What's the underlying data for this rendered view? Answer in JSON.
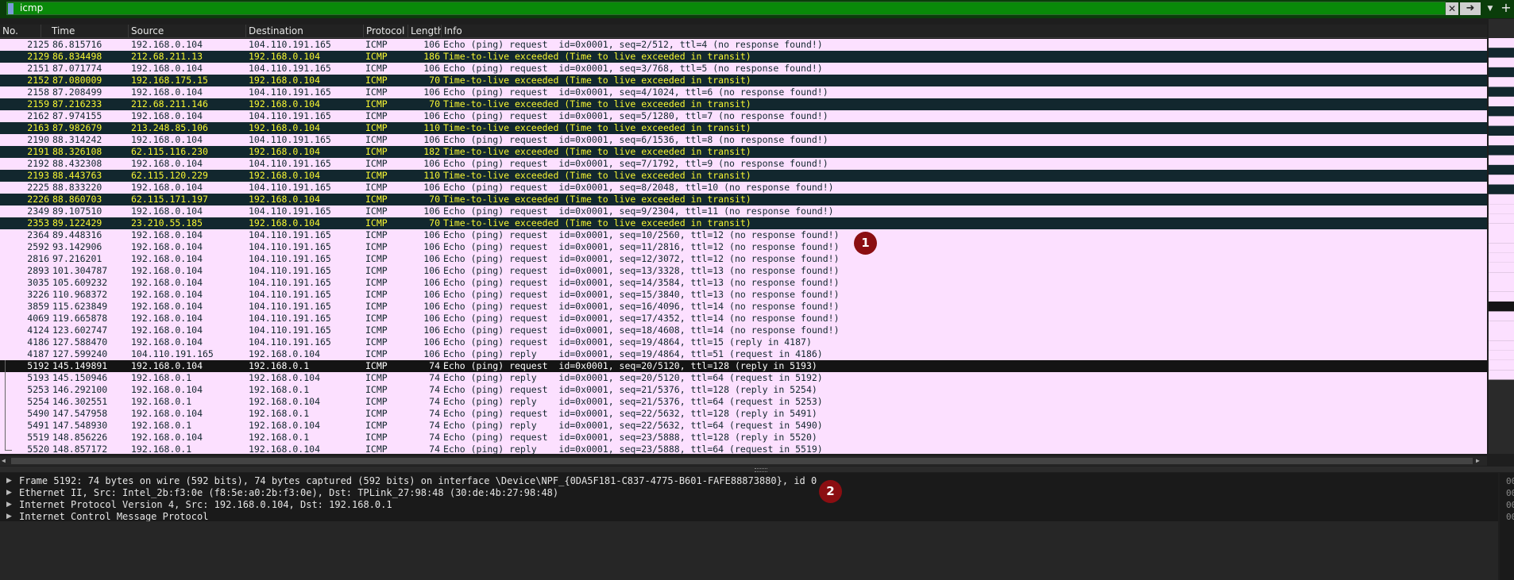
{
  "filter": {
    "value": "icmp",
    "clear_glyph": "✕",
    "apply_glyph": "➜",
    "dropdown_glyph": "▼",
    "add_glyph": "+"
  },
  "columns": [
    "No.",
    "Time",
    "Source",
    "Destination",
    "Protocol",
    "Length",
    "Info"
  ],
  "packets": [
    {
      "no": "2125",
      "time": "86.815716",
      "src": "192.168.0.104",
      "dst": "104.110.191.165",
      "proto": "ICMP",
      "len": "106",
      "info": "Echo (ping) request  id=0x0001, seq=2/512, ttl=4 (no response found!)",
      "kind": "echo"
    },
    {
      "no": "2129",
      "time": "86.834498",
      "src": "212.68.211.13",
      "dst": "192.168.0.104",
      "proto": "ICMP",
      "len": "186",
      "info": "Time-to-live exceeded (Time to live exceeded in transit)",
      "kind": "ttl"
    },
    {
      "no": "2151",
      "time": "87.071774",
      "src": "192.168.0.104",
      "dst": "104.110.191.165",
      "proto": "ICMP",
      "len": "106",
      "info": "Echo (ping) request  id=0x0001, seq=3/768, ttl=5 (no response found!)",
      "kind": "echo"
    },
    {
      "no": "2152",
      "time": "87.080009",
      "src": "192.168.175.15",
      "dst": "192.168.0.104",
      "proto": "ICMP",
      "len": "70",
      "info": "Time-to-live exceeded (Time to live exceeded in transit)",
      "kind": "ttl"
    },
    {
      "no": "2158",
      "time": "87.208499",
      "src": "192.168.0.104",
      "dst": "104.110.191.165",
      "proto": "ICMP",
      "len": "106",
      "info": "Echo (ping) request  id=0x0001, seq=4/1024, ttl=6 (no response found!)",
      "kind": "echo"
    },
    {
      "no": "2159",
      "time": "87.216233",
      "src": "212.68.211.146",
      "dst": "192.168.0.104",
      "proto": "ICMP",
      "len": "70",
      "info": "Time-to-live exceeded (Time to live exceeded in transit)",
      "kind": "ttl"
    },
    {
      "no": "2162",
      "time": "87.974155",
      "src": "192.168.0.104",
      "dst": "104.110.191.165",
      "proto": "ICMP",
      "len": "106",
      "info": "Echo (ping) request  id=0x0001, seq=5/1280, ttl=7 (no response found!)",
      "kind": "echo"
    },
    {
      "no": "2163",
      "time": "87.982679",
      "src": "213.248.85.106",
      "dst": "192.168.0.104",
      "proto": "ICMP",
      "len": "110",
      "info": "Time-to-live exceeded (Time to live exceeded in transit)",
      "kind": "ttl"
    },
    {
      "no": "2190",
      "time": "88.314242",
      "src": "192.168.0.104",
      "dst": "104.110.191.165",
      "proto": "ICMP",
      "len": "106",
      "info": "Echo (ping) request  id=0x0001, seq=6/1536, ttl=8 (no response found!)",
      "kind": "echo"
    },
    {
      "no": "2191",
      "time": "88.326108",
      "src": "62.115.116.230",
      "dst": "192.168.0.104",
      "proto": "ICMP",
      "len": "182",
      "info": "Time-to-live exceeded (Time to live exceeded in transit)",
      "kind": "ttl"
    },
    {
      "no": "2192",
      "time": "88.432308",
      "src": "192.168.0.104",
      "dst": "104.110.191.165",
      "proto": "ICMP",
      "len": "106",
      "info": "Echo (ping) request  id=0x0001, seq=7/1792, ttl=9 (no response found!)",
      "kind": "echo"
    },
    {
      "no": "2193",
      "time": "88.443763",
      "src": "62.115.120.229",
      "dst": "192.168.0.104",
      "proto": "ICMP",
      "len": "110",
      "info": "Time-to-live exceeded (Time to live exceeded in transit)",
      "kind": "ttl"
    },
    {
      "no": "2225",
      "time": "88.833220",
      "src": "192.168.0.104",
      "dst": "104.110.191.165",
      "proto": "ICMP",
      "len": "106",
      "info": "Echo (ping) request  id=0x0001, seq=8/2048, ttl=10 (no response found!)",
      "kind": "echo"
    },
    {
      "no": "2226",
      "time": "88.860703",
      "src": "62.115.171.197",
      "dst": "192.168.0.104",
      "proto": "ICMP",
      "len": "70",
      "info": "Time-to-live exceeded (Time to live exceeded in transit)",
      "kind": "ttl"
    },
    {
      "no": "2349",
      "time": "89.107510",
      "src": "192.168.0.104",
      "dst": "104.110.191.165",
      "proto": "ICMP",
      "len": "106",
      "info": "Echo (ping) request  id=0x0001, seq=9/2304, ttl=11 (no response found!)",
      "kind": "echo"
    },
    {
      "no": "2353",
      "time": "89.122429",
      "src": "23.210.55.185",
      "dst": "192.168.0.104",
      "proto": "ICMP",
      "len": "70",
      "info": "Time-to-live exceeded (Time to live exceeded in transit)",
      "kind": "ttl"
    },
    {
      "no": "2364",
      "time": "89.448316",
      "src": "192.168.0.104",
      "dst": "104.110.191.165",
      "proto": "ICMP",
      "len": "106",
      "info": "Echo (ping) request  id=0x0001, seq=10/2560, ttl=12 (no response found!)",
      "kind": "echo"
    },
    {
      "no": "2592",
      "time": "93.142906",
      "src": "192.168.0.104",
      "dst": "104.110.191.165",
      "proto": "ICMP",
      "len": "106",
      "info": "Echo (ping) request  id=0x0001, seq=11/2816, ttl=12 (no response found!)",
      "kind": "echo"
    },
    {
      "no": "2816",
      "time": "97.216201",
      "src": "192.168.0.104",
      "dst": "104.110.191.165",
      "proto": "ICMP",
      "len": "106",
      "info": "Echo (ping) request  id=0x0001, seq=12/3072, ttl=12 (no response found!)",
      "kind": "echo"
    },
    {
      "no": "2893",
      "time": "101.304787",
      "src": "192.168.0.104",
      "dst": "104.110.191.165",
      "proto": "ICMP",
      "len": "106",
      "info": "Echo (ping) request  id=0x0001, seq=13/3328, ttl=13 (no response found!)",
      "kind": "echo"
    },
    {
      "no": "3035",
      "time": "105.609232",
      "src": "192.168.0.104",
      "dst": "104.110.191.165",
      "proto": "ICMP",
      "len": "106",
      "info": "Echo (ping) request  id=0x0001, seq=14/3584, ttl=13 (no response found!)",
      "kind": "echo"
    },
    {
      "no": "3226",
      "time": "110.968372",
      "src": "192.168.0.104",
      "dst": "104.110.191.165",
      "proto": "ICMP",
      "len": "106",
      "info": "Echo (ping) request  id=0x0001, seq=15/3840, ttl=13 (no response found!)",
      "kind": "echo"
    },
    {
      "no": "3859",
      "time": "115.623849",
      "src": "192.168.0.104",
      "dst": "104.110.191.165",
      "proto": "ICMP",
      "len": "106",
      "info": "Echo (ping) request  id=0x0001, seq=16/4096, ttl=14 (no response found!)",
      "kind": "echo"
    },
    {
      "no": "4069",
      "time": "119.665878",
      "src": "192.168.0.104",
      "dst": "104.110.191.165",
      "proto": "ICMP",
      "len": "106",
      "info": "Echo (ping) request  id=0x0001, seq=17/4352, ttl=14 (no response found!)",
      "kind": "echo"
    },
    {
      "no": "4124",
      "time": "123.602747",
      "src": "192.168.0.104",
      "dst": "104.110.191.165",
      "proto": "ICMP",
      "len": "106",
      "info": "Echo (ping) request  id=0x0001, seq=18/4608, ttl=14 (no response found!)",
      "kind": "echo"
    },
    {
      "no": "4186",
      "time": "127.588470",
      "src": "192.168.0.104",
      "dst": "104.110.191.165",
      "proto": "ICMP",
      "len": "106",
      "info": "Echo (ping) request  id=0x0001, seq=19/4864, ttl=15 (reply in 4187)",
      "kind": "echo"
    },
    {
      "no": "4187",
      "time": "127.599240",
      "src": "104.110.191.165",
      "dst": "192.168.0.104",
      "proto": "ICMP",
      "len": "106",
      "info": "Echo (ping) reply    id=0x0001, seq=19/4864, ttl=51 (request in 4186)",
      "kind": "echo"
    },
    {
      "no": "5192",
      "time": "145.149891",
      "src": "192.168.0.104",
      "dst": "192.168.0.1",
      "proto": "ICMP",
      "len": "74",
      "info": "Echo (ping) request  id=0x0001, seq=20/5120, ttl=128 (reply in 5193)",
      "kind": "sel"
    },
    {
      "no": "5193",
      "time": "145.150946",
      "src": "192.168.0.1",
      "dst": "192.168.0.104",
      "proto": "ICMP",
      "len": "74",
      "info": "Echo (ping) reply    id=0x0001, seq=20/5120, ttl=64 (request in 5192)",
      "kind": "echo"
    },
    {
      "no": "5253",
      "time": "146.292100",
      "src": "192.168.0.104",
      "dst": "192.168.0.1",
      "proto": "ICMP",
      "len": "74",
      "info": "Echo (ping) request  id=0x0001, seq=21/5376, ttl=128 (reply in 5254)",
      "kind": "echo"
    },
    {
      "no": "5254",
      "time": "146.302551",
      "src": "192.168.0.1",
      "dst": "192.168.0.104",
      "proto": "ICMP",
      "len": "74",
      "info": "Echo (ping) reply    id=0x0001, seq=21/5376, ttl=64 (request in 5253)",
      "kind": "echo"
    },
    {
      "no": "5490",
      "time": "147.547958",
      "src": "192.168.0.104",
      "dst": "192.168.0.1",
      "proto": "ICMP",
      "len": "74",
      "info": "Echo (ping) request  id=0x0001, seq=22/5632, ttl=128 (reply in 5491)",
      "kind": "echo"
    },
    {
      "no": "5491",
      "time": "147.548930",
      "src": "192.168.0.1",
      "dst": "192.168.0.104",
      "proto": "ICMP",
      "len": "74",
      "info": "Echo (ping) reply    id=0x0001, seq=22/5632, ttl=64 (request in 5490)",
      "kind": "echo"
    },
    {
      "no": "5519",
      "time": "148.856226",
      "src": "192.168.0.104",
      "dst": "192.168.0.1",
      "proto": "ICMP",
      "len": "74",
      "info": "Echo (ping) request  id=0x0001, seq=23/5888, ttl=128 (reply in 5520)",
      "kind": "echo"
    },
    {
      "no": "5520",
      "time": "148.857172",
      "src": "192.168.0.1",
      "dst": "192.168.0.104",
      "proto": "ICMP",
      "len": "74",
      "info": "Echo (ping) reply    id=0x0001, seq=23/5888, ttl=64 (request in 5519)",
      "kind": "echo"
    }
  ],
  "details": [
    "Frame 5192: 74 bytes on wire (592 bits), 74 bytes captured (592 bits) on interface \\Device\\NPF_{0DA5F181-C837-4775-B601-FAFE88873880}, id 0",
    "Ethernet II, Src: Intel_2b:f3:0e (f8:5e:a0:2b:f3:0e), Dst: TPLink_27:98:48 (30:de:4b:27:98:48)",
    "Internet Protocol Version 4, Src: 192.168.0.104, Dst: 192.168.0.1",
    "Internet Control Message Protocol"
  ],
  "bytes_pane": [
    "00",
    "00",
    "00",
    "00"
  ],
  "markers": [
    "1",
    "2"
  ],
  "colors": {
    "echo_bg": "#fce0ff",
    "ttl_bg": "#12272e",
    "ttl_fg": "#f7f632",
    "selected_bg": "#141414",
    "filter_bg": "#098a09",
    "marker_bg": "#8b0e12"
  }
}
